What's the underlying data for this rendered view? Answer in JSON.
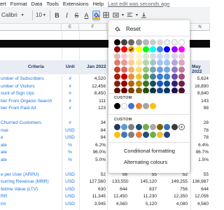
{
  "menubar": {
    "items": [
      "ert",
      "Format",
      "Data",
      "Tools",
      "Extensions",
      "Help"
    ],
    "last_edit": "Last edit was seconds ago"
  },
  "toolbar": {
    "font": "Calibri",
    "font_size": "10",
    "bold": "B",
    "italic": "I",
    "strike": "S",
    "text_color": "A",
    "fill_color_hex": "#ff9900"
  },
  "columns": [
    "",
    "E",
    "F",
    "G",
    "",
    "",
    "",
    "",
    "N"
  ],
  "header": {
    "criteria": "Criteria",
    "unit": "Unit",
    "jan": "Jan 2022",
    "may": "May 2022"
  },
  "rows": [
    {
      "label": "umber of Subscribers",
      "unit": "#",
      "jan": "4,520",
      "may": "5,624"
    },
    {
      "label": "umber of Visitors",
      "unit": "#",
      "jan": "12,456",
      "may": "16,890"
    },
    {
      "label": "ount of Sign Ups",
      "unit": "#",
      "jan": "8,450",
      "may": "9,840"
    },
    {
      "label": "ber From Organic Search",
      "unit": "#",
      "jan": "111",
      "may": "143"
    },
    {
      "label": "ber From Paid Ad",
      "unit": "#",
      "jan": "123",
      "may": "98"
    },
    {
      "label": "",
      "unit": "",
      "jan": "",
      "may": ""
    },
    {
      "label": "Churned Customers",
      "unit": "#",
      "jan": "34",
      "may": "28"
    },
    {
      "label": "nue",
      "unit": "USD",
      "jan": "84",
      "may": "78"
    },
    {
      "label": "e",
      "unit": "USD",
      "jan": "84",
      "may": "78"
    },
    {
      "label": "ate",
      "unit": "%",
      "jan": "6.2%",
      "may": "6.4%"
    },
    {
      "label": "ate",
      "unit": "%",
      "jan": "96.0%",
      "may": "96.7%"
    },
    {
      "label": "ate",
      "unit": "%",
      "jan": "5.0%",
      "may": "1.5%"
    },
    {
      "label": "",
      "unit": "",
      "jan": "",
      "may": ""
    },
    {
      "label": "e per User (ARPU)",
      "unit": "USD",
      "jan": "52",
      "may": "55"
    },
    {
      "label": "curring Revenue (MRR)",
      "unit": "USD",
      "jan": "127,560",
      "may": "136,987"
    },
    {
      "label": "fetime Value (LTV)",
      "unit": "USD",
      "jan": "630",
      "may": "644"
    },
    {
      "label": "RR",
      "unit": "USD",
      "jan": "11,345",
      "may": "12,056"
    },
    {
      "label": "rm",
      "unit": "USD",
      "jan": "3,945",
      "may": "4,560"
    }
  ],
  "hidden_cols": {
    "g": [
      "",
      "",
      "",
      "",
      "",
      "",
      "",
      "",
      "",
      "",
      "",
      "",
      "",
      "56",
      "133,550",
      "644",
      "12,450",
      "4,560"
    ],
    "h": [
      "",
      "",
      "",
      "",
      "",
      "",
      "",
      "",
      "",
      "",
      "",
      "",
      "",
      "55",
      "145,120",
      "837",
      "11,230",
      "5,120"
    ],
    "i": [
      "",
      "",
      "",
      "",
      "",
      "",
      "",
      "",
      "",
      "",
      "",
      "",
      "",
      "52",
      "149,255",
      "756",
      "12,350",
      "4,080"
    ]
  },
  "color_menu": {
    "reset_label": "Reset",
    "custom_label": "CUSTOM",
    "custom_label_2": "CUSTOM",
    "conditional_formatting": "Conditional formatting",
    "alternating_colours": "Alternating colours",
    "palette_rows": [
      [
        "#000000",
        "#434343",
        "#666666",
        "#999999",
        "#b7b7b7",
        "#cccccc",
        "#d9d9d9",
        "#efefef",
        "#f3f3f3",
        "#ffffff"
      ],
      [
        "#980000",
        "#ff0000",
        "#ff9900",
        "#ffff00",
        "#00ff00",
        "#00ffff",
        "#4a86e8",
        "#0000ff",
        "#9900ff",
        "#ff00ff"
      ],
      [
        "#e6b8af",
        "#f4cccc",
        "#fce5cd",
        "#fff2cc",
        "#d9ead3",
        "#d0e0e3",
        "#c9daf8",
        "#cfe2f3",
        "#d9d2e9",
        "#ead1dc"
      ],
      [
        "#dd7e6b",
        "#ea9999",
        "#f9cb9c",
        "#ffe599",
        "#b6d7a8",
        "#a2c4c9",
        "#a4c2f4",
        "#9fc5e8",
        "#b4a7d6",
        "#d5a6bd"
      ],
      [
        "#cc4125",
        "#e06666",
        "#f6b26b",
        "#ffd966",
        "#93c47d",
        "#76a5af",
        "#6d9eeb",
        "#6fa8dc",
        "#8e7cc3",
        "#c27ba0"
      ],
      [
        "#a61c00",
        "#cc0000",
        "#e69138",
        "#f1c232",
        "#6aa84f",
        "#45818e",
        "#3c78d8",
        "#3d85c6",
        "#674ea7",
        "#a64d79"
      ],
      [
        "#85200c",
        "#990000",
        "#b45f06",
        "#bf9000",
        "#38761d",
        "#134f5c",
        "#1155cc",
        "#0b5394",
        "#351c75",
        "#741b47"
      ],
      [
        "#5b0f00",
        "#660000",
        "#783f04",
        "#7f6000",
        "#274e13",
        "#0c343d",
        "#1c4587",
        "#073763",
        "#20124d",
        "#4c1130"
      ]
    ],
    "selected": "#ff9900",
    "custom_row_1": [
      "#000000",
      "#ffffff",
      "#4472c4",
      "#ed7d31",
      "#a5a5a5",
      "#ffc000"
    ],
    "custom_row_2_a": [
      "#1f3864",
      "#5b9bd5",
      "#808080",
      "#1f4e79",
      "#70ad47",
      "#a9a9a9",
      "#7f6000",
      "#2e75b6",
      "#3a3a3a"
    ],
    "custom_row_2_b": [
      "#ffc000",
      "#4472c4",
      "#808080",
      "#ed7d31",
      "#1f4e79",
      "#70ad47",
      "#e8bf3a",
      "#264478"
    ]
  }
}
